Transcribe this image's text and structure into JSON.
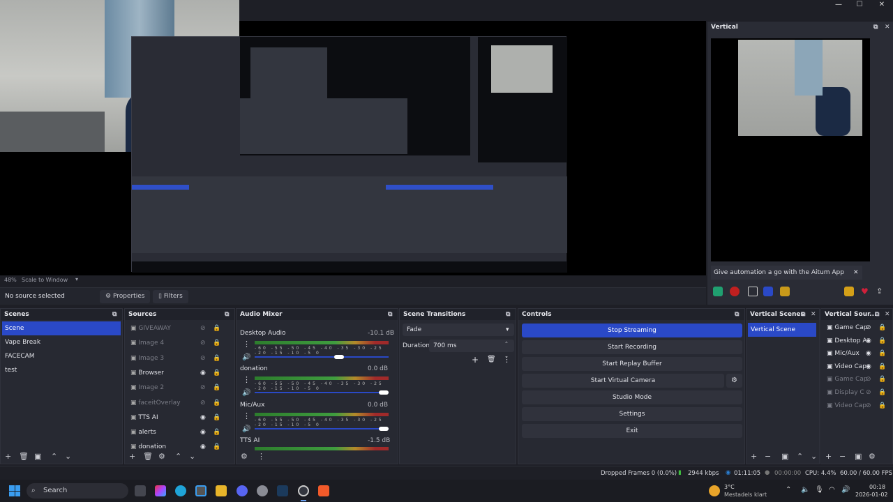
{
  "window": {
    "minimize": "—",
    "maximize": "☐",
    "close": "✕"
  },
  "preview": {
    "zoom": "48%",
    "scale_mode": "Scale to Window"
  },
  "toolbar": {
    "no_source": "No source selected",
    "properties": "Properties",
    "filters": "Filters"
  },
  "vertical": {
    "title": "Vertical",
    "notice": "Give automation a go with the Aitum App",
    "notice_close": "✕"
  },
  "scenes": {
    "title": "Scenes",
    "items": [
      "Scene",
      "Vape Break",
      "FACECAM",
      "test"
    ],
    "selected": "Scene"
  },
  "sources": {
    "title": "Sources",
    "items": [
      {
        "label": "GIVEAWAY",
        "visible": false
      },
      {
        "label": "Image 4",
        "visible": false
      },
      {
        "label": "Image 3",
        "visible": false
      },
      {
        "label": "Browser",
        "visible": true
      },
      {
        "label": "Image 2",
        "visible": false
      },
      {
        "label": "faceitOverlay",
        "visible": false
      },
      {
        "label": "TTS AI",
        "visible": true
      },
      {
        "label": "alerts",
        "visible": true
      },
      {
        "label": "donation",
        "visible": true
      }
    ]
  },
  "mixer": {
    "title": "Audio Mixer",
    "channels": [
      {
        "name": "Desktop Audio",
        "db": "-10.1 dB"
      },
      {
        "name": "donation",
        "db": "0.0 dB"
      },
      {
        "name": "Mic/Aux",
        "db": "0.0 dB"
      },
      {
        "name": "TTS AI",
        "db": "-1.5 dB"
      }
    ],
    "scale": "-60 -55 -50 -45 -40 -35 -30 -25 -20 -15 -10 -5 0"
  },
  "transitions": {
    "title": "Scene Transitions",
    "type": "Fade",
    "duration_label": "Duration",
    "duration": "700 ms"
  },
  "controls": {
    "title": "Controls",
    "buttons": [
      "Stop Streaming",
      "Start Recording",
      "Start Replay Buffer",
      "Start Virtual Camera",
      "Studio Mode",
      "Settings",
      "Exit"
    ]
  },
  "vscenes": {
    "title": "Vertical Scenes",
    "items": [
      "Vertical Scene"
    ]
  },
  "vsources": {
    "title": "Vertical Sour...",
    "items": [
      "Game Cap",
      "Desktop A",
      "Mic/Aux",
      "Video Cap",
      "Game Cap",
      "Display C",
      "Video Cap"
    ]
  },
  "status": {
    "dropped": "Dropped Frames 0 (0.0%)",
    "kbps": "2944 kbps",
    "stream_time": "01:11:05",
    "rec_time": "00:00:00",
    "cpu": "CPU: 4.4%",
    "fps": "60.00 / 60.00 FPS"
  },
  "taskbar": {
    "search": "Search",
    "weather_temp": "3°C",
    "weather_desc": "Mestadels klart",
    "time": "00:18",
    "date": "2026-01-02"
  },
  "colors": {
    "accent": "#2a49c7",
    "panel": "#272932",
    "bg": "#1e1f26"
  }
}
